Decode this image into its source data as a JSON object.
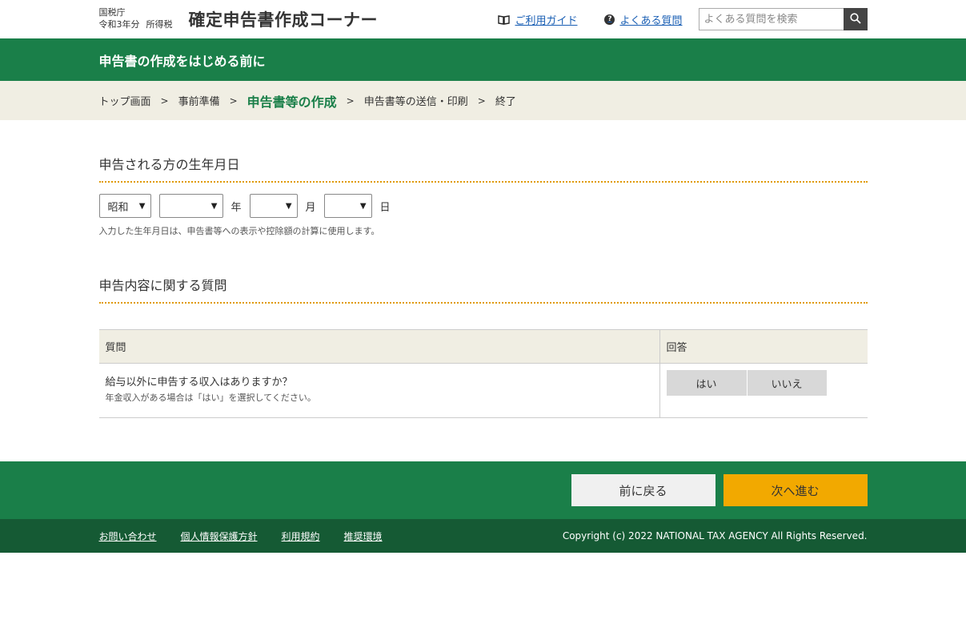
{
  "header": {
    "agency_line1": "国税庁",
    "agency_year": "令和3年分",
    "agency_tax": "所得税",
    "site_title": "確定申告書作成コーナー",
    "guide_label": "ご利用ガイド",
    "faq_label": "よくある質問",
    "search_placeholder": "よくある質問を検索",
    "icons": {
      "guide": "book-icon",
      "faq": "question-circle-icon",
      "search": "search-icon"
    }
  },
  "title_bar": {
    "title": "申告書の作成をはじめる前に"
  },
  "steps": [
    {
      "label": "トップ画面",
      "current": false
    },
    {
      "label": "事前準備",
      "current": false
    },
    {
      "label": "申告書等の作成",
      "current": true
    },
    {
      "label": "申告書等の送信・印刷",
      "current": false
    },
    {
      "label": "終了",
      "current": false
    }
  ],
  "birthdate": {
    "heading": "申告される方の生年月日",
    "era_selected": "昭和",
    "year_selected": "",
    "month_selected": "",
    "day_selected": "",
    "year_unit": "年",
    "month_unit": "月",
    "day_unit": "日",
    "note": "入力した生年月日は、申告書等への表示や控除額の計算に使用します。"
  },
  "questions": {
    "heading": "申告内容に関する質問",
    "col_question": "質問",
    "col_answer": "回答",
    "rows": [
      {
        "question": "給与以外に申告する収入はありますか？",
        "sub": "年金収入がある場合は「はい」を選択してください。",
        "yes_label": "はい",
        "no_label": "いいえ"
      }
    ]
  },
  "nav": {
    "back_label": "前に戻る",
    "next_label": "次へ進む"
  },
  "footer": {
    "links": [
      "お問い合わせ",
      "個人情報保護方針",
      "利用規約",
      "推奨環境"
    ],
    "copyright": "Copyright (c) 2022 NATIONAL TAX AGENCY All Rights Reserved."
  },
  "colors": {
    "brand_green": "#1a7f49",
    "footer_green": "#155a34",
    "step_bg": "#f0eee3",
    "next_button": "#f2a900",
    "divider_orange": "#e09a00",
    "link_blue": "#1a5fb4"
  }
}
